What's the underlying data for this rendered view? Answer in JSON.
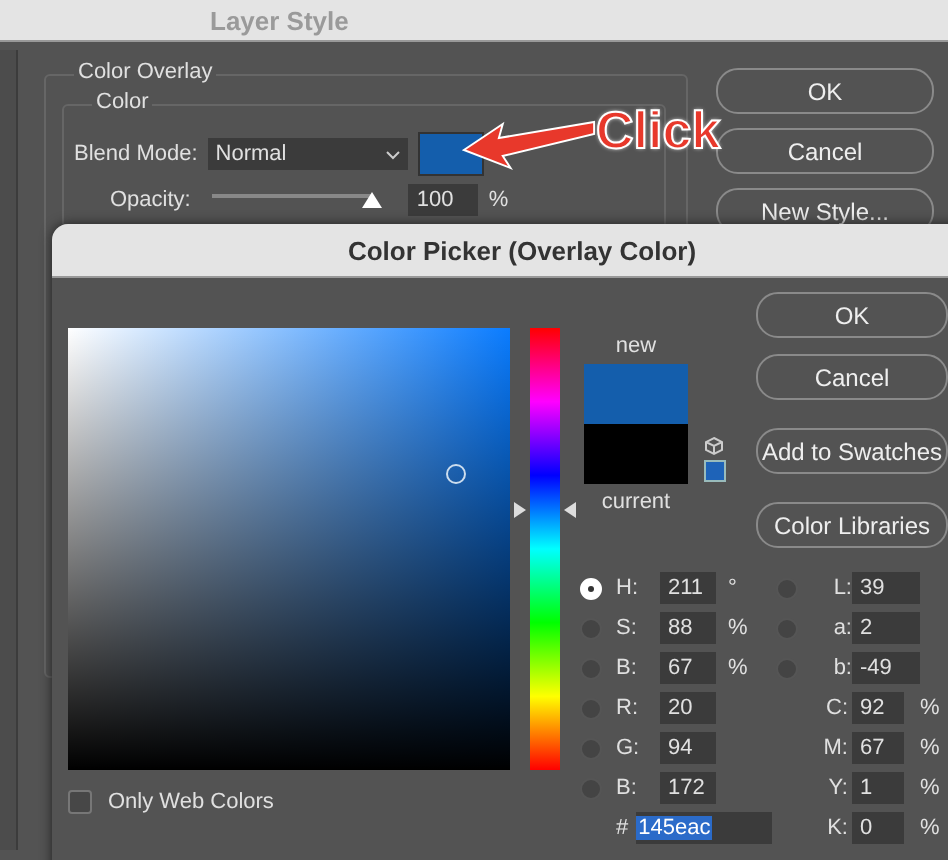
{
  "layer_style": {
    "title": "Layer Style",
    "section": "Color Overlay",
    "group": "Color",
    "blend_mode_label": "Blend Mode:",
    "blend_mode": "Normal",
    "opacity_label": "Opacity:",
    "opacity": {
      "level": 1.0,
      "value": "100",
      "unit": "%"
    },
    "buttons": [
      "OK",
      "Cancel",
      "New Style..."
    ]
  },
  "annotation": {
    "text": "Click"
  },
  "color_picker": {
    "title": "Color Picker (Overlay Color)",
    "new_label": "new",
    "current_label": "current",
    "buttons": [
      "OK",
      "Cancel",
      "Add to Swatches",
      "Color Libraries"
    ],
    "only_web_colors": {
      "label": "Only Web Colors",
      "checked": false
    },
    "rows": [
      {
        "left": {
          "label": "H:",
          "value": "211",
          "unit": "°",
          "selected": true
        },
        "right": {
          "kind": "lab",
          "label": "L:",
          "value": "39",
          "selected": false
        }
      },
      {
        "left": {
          "label": "S:",
          "value": "88",
          "unit": "%",
          "selected": false
        },
        "right": {
          "kind": "lab",
          "label": "a:",
          "value": "2",
          "selected": false
        }
      },
      {
        "left": {
          "label": "B:",
          "value": "67",
          "unit": "%",
          "selected": false
        },
        "right": {
          "kind": "lab",
          "label": "b:",
          "value": "-49",
          "selected": false
        }
      },
      {
        "left": {
          "label": "R:",
          "value": "20",
          "selected": false
        },
        "right": {
          "kind": "cmyk",
          "label": "C:",
          "value": "92",
          "unit": "%"
        }
      },
      {
        "left": {
          "label": "G:",
          "value": "94",
          "selected": false
        },
        "right": {
          "kind": "cmyk",
          "label": "M:",
          "value": "67",
          "unit": "%"
        }
      },
      {
        "left": {
          "label": "B:",
          "value": "172",
          "selected": false
        },
        "right": {
          "kind": "cmyk",
          "label": "Y:",
          "value": "1",
          "unit": "%"
        }
      }
    ],
    "hex": {
      "label": "#",
      "value": "145eac"
    },
    "k_row": {
      "kind": "cmyk",
      "label": "K:",
      "value": "0",
      "unit": "%"
    }
  }
}
